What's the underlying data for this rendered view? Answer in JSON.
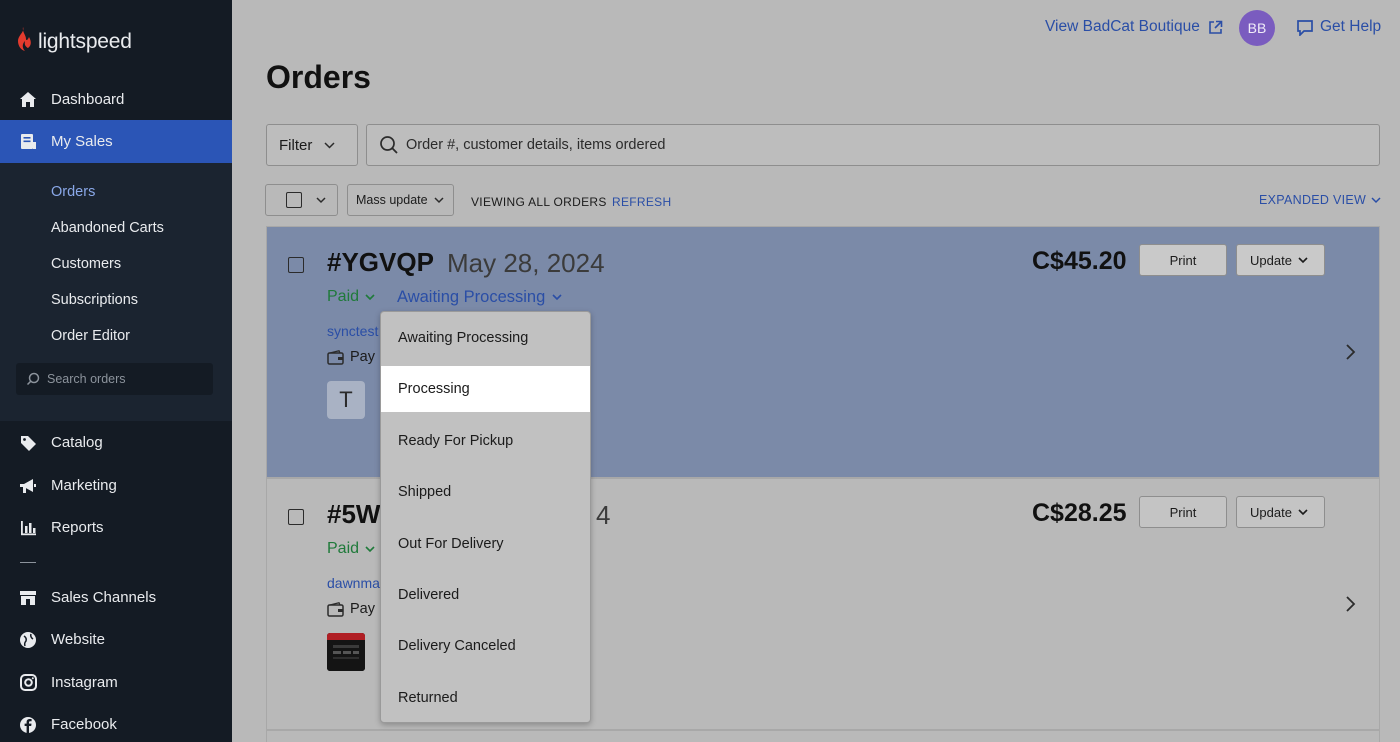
{
  "brand": {
    "name": "lightspeed"
  },
  "sidebar": {
    "items": [
      {
        "label": "Dashboard",
        "icon": "home-icon"
      },
      {
        "label": "My Sales",
        "icon": "receipt-icon",
        "active": true
      },
      {
        "label": "Catalog",
        "icon": "tag-icon"
      },
      {
        "label": "Marketing",
        "icon": "megaphone-icon"
      },
      {
        "label": "Reports",
        "icon": "bar-chart-icon"
      },
      {
        "label": "Sales Channels",
        "icon": "storefront-icon"
      },
      {
        "label": "Website",
        "icon": "globe-icon"
      },
      {
        "label": "Instagram",
        "icon": "instagram-icon"
      },
      {
        "label": "Facebook",
        "icon": "facebook-icon"
      }
    ],
    "sub_items": [
      {
        "label": "Orders",
        "current": true
      },
      {
        "label": "Abandoned Carts"
      },
      {
        "label": "Customers"
      },
      {
        "label": "Subscriptions"
      },
      {
        "label": "Order Editor"
      }
    ],
    "search_placeholder": "Search orders"
  },
  "topbar": {
    "store_link": "View BadCat Boutique",
    "avatar_initials": "BB",
    "help_link": "Get Help"
  },
  "page": {
    "title": "Orders",
    "filter_label": "Filter",
    "search_placeholder": "Order #, customer details, items ordered",
    "mass_update_label": "Mass update",
    "viewing_label": "VIEWING ALL ORDERS",
    "refresh_label": "REFRESH",
    "view_mode_label": "EXPANDED VIEW"
  },
  "orders": [
    {
      "id": "#YGVQP",
      "date": "May 28, 2024",
      "payment_status": "Paid",
      "fulfillment_status": "Awaiting Processing",
      "customer": "synctest",
      "payment_method": "Pay",
      "thumbnail_letter": "T",
      "total": "C$45.20",
      "print_label": "Print",
      "update_label": "Update"
    },
    {
      "id": "#5W",
      "date": "4",
      "payment_status": "Paid",
      "customer": "dawnma",
      "payment_method": "Pay",
      "total": "C$28.25",
      "print_label": "Print",
      "update_label": "Update"
    }
  ],
  "status_dropdown": {
    "options": [
      "Awaiting Processing",
      "Processing",
      "Ready For Pickup",
      "Shipped",
      "Out For Delivery",
      "Delivered",
      "Delivery Canceled",
      "Returned"
    ],
    "highlighted": "Processing"
  },
  "colors": {
    "sidebar_bg": "#141b24",
    "active_nav": "#2b55b6",
    "link": "#2a4ea6",
    "paid_green": "#1f7a3a",
    "avatar": "#7a5cbf",
    "brand_red": "#e33b2e"
  }
}
